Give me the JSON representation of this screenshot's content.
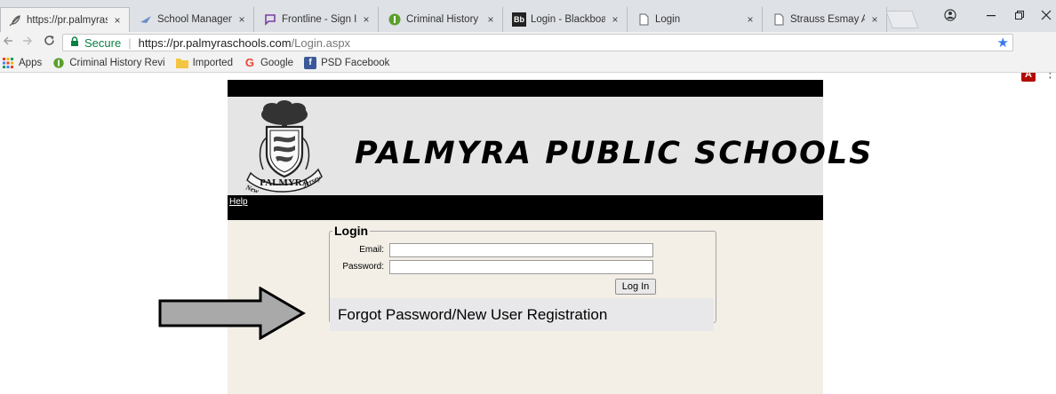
{
  "browser": {
    "tabs": [
      {
        "title": "https://pr.palmyrasch",
        "icon": "feather-icon"
      },
      {
        "title": "School Management",
        "icon": "bird-icon"
      },
      {
        "title": "Frontline - Sign In",
        "icon": "frontline-icon"
      },
      {
        "title": "Criminal History Rev",
        "icon": "shield-icon"
      },
      {
        "title": "Login - Blackboard",
        "icon": "blackboard-icon",
        "icon_text": "Bb"
      },
      {
        "title": "Login",
        "icon": "page-icon"
      },
      {
        "title": "Strauss Esmay Assoc",
        "icon": "page-icon"
      }
    ],
    "close_glyph": "×",
    "address": {
      "secure_label": "Secure",
      "separator": "|",
      "url_host": "https://pr.palmyraschools.com",
      "url_path": "/Login.aspx"
    },
    "bookmarks": [
      {
        "label": "Apps",
        "icon": "apps-icon"
      },
      {
        "label": "Criminal History Revi",
        "icon": "shield-icon"
      },
      {
        "label": "Imported",
        "icon": "folder-icon"
      },
      {
        "label": "Google",
        "icon": "google-icon",
        "icon_text": "G"
      },
      {
        "label": "PSD Facebook",
        "icon": "facebook-icon",
        "icon_text": "f"
      }
    ],
    "pdf_ext_text": "A",
    "colors": {
      "secure": "#0b8043",
      "star": "#3b78e7",
      "facebook": "#3b5998",
      "folder": "#f4c542"
    }
  },
  "page": {
    "school_name": "PALMYRA PUBLIC SCHOOLS",
    "help_link": "Help",
    "crest_text": {
      "left": "New",
      "middle": "PALMYRA",
      "right": "Jersey"
    },
    "login": {
      "legend": "Login",
      "email_label": "Email:",
      "password_label": "Password:",
      "email_value": "",
      "password_value": "",
      "submit_label": "Log In",
      "forgot_link": "Forgot Password/New User Registration"
    }
  }
}
